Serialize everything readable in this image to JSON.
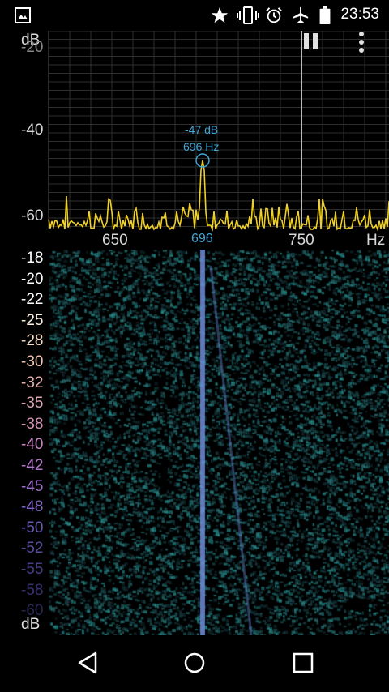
{
  "status_bar": {
    "time": "23:53",
    "icons": [
      "image-icon",
      "star-icon",
      "vibrate-icon",
      "alarm-icon",
      "airplane-icon",
      "battery-icon"
    ]
  },
  "spectrum": {
    "y_unit": "dB",
    "y_ticks": [
      "-20",
      "-40",
      "-60"
    ],
    "x_ticks": [
      "650",
      "696",
      "750"
    ],
    "x_unit": "Hz",
    "peak_db": "-47 dB",
    "peak_freq": "696 Hz",
    "colors": {
      "trace": "#f0d020",
      "peak": "#3fa7d6",
      "grid": "#3a3a3a",
      "cursor": "#bbbbbb"
    }
  },
  "controls": {
    "icons": [
      "pause-icon",
      "more-vert-icon"
    ]
  },
  "spectrogram": {
    "db_scale": [
      {
        "label": "-18",
        "color": "#ffffff"
      },
      {
        "label": "-20",
        "color": "#ffffff"
      },
      {
        "label": "-22",
        "color": "#ffffff"
      },
      {
        "label": "-25",
        "color": "#fff4e6"
      },
      {
        "label": "-28",
        "color": "#f4d8c0"
      },
      {
        "label": "-30",
        "color": "#eec4b0"
      },
      {
        "label": "-32",
        "color": "#e6b0b0"
      },
      {
        "label": "-35",
        "color": "#dca6b4"
      },
      {
        "label": "-38",
        "color": "#d596b8"
      },
      {
        "label": "-40",
        "color": "#c884c2"
      },
      {
        "label": "-42",
        "color": "#b478c8"
      },
      {
        "label": "-45",
        "color": "#9c6ccc"
      },
      {
        "label": "-48",
        "color": "#7e62c4"
      },
      {
        "label": "-50",
        "color": "#6858b2"
      },
      {
        "label": "-52",
        "color": "#564c9c"
      },
      {
        "label": "-55",
        "color": "#463e82"
      },
      {
        "label": "-58",
        "color": "#38326c"
      },
      {
        "label": "-60",
        "color": "#2a2856"
      }
    ],
    "unit": "dB"
  },
  "navigation": {
    "icons": [
      "back-icon",
      "home-icon",
      "recents-icon"
    ]
  }
}
